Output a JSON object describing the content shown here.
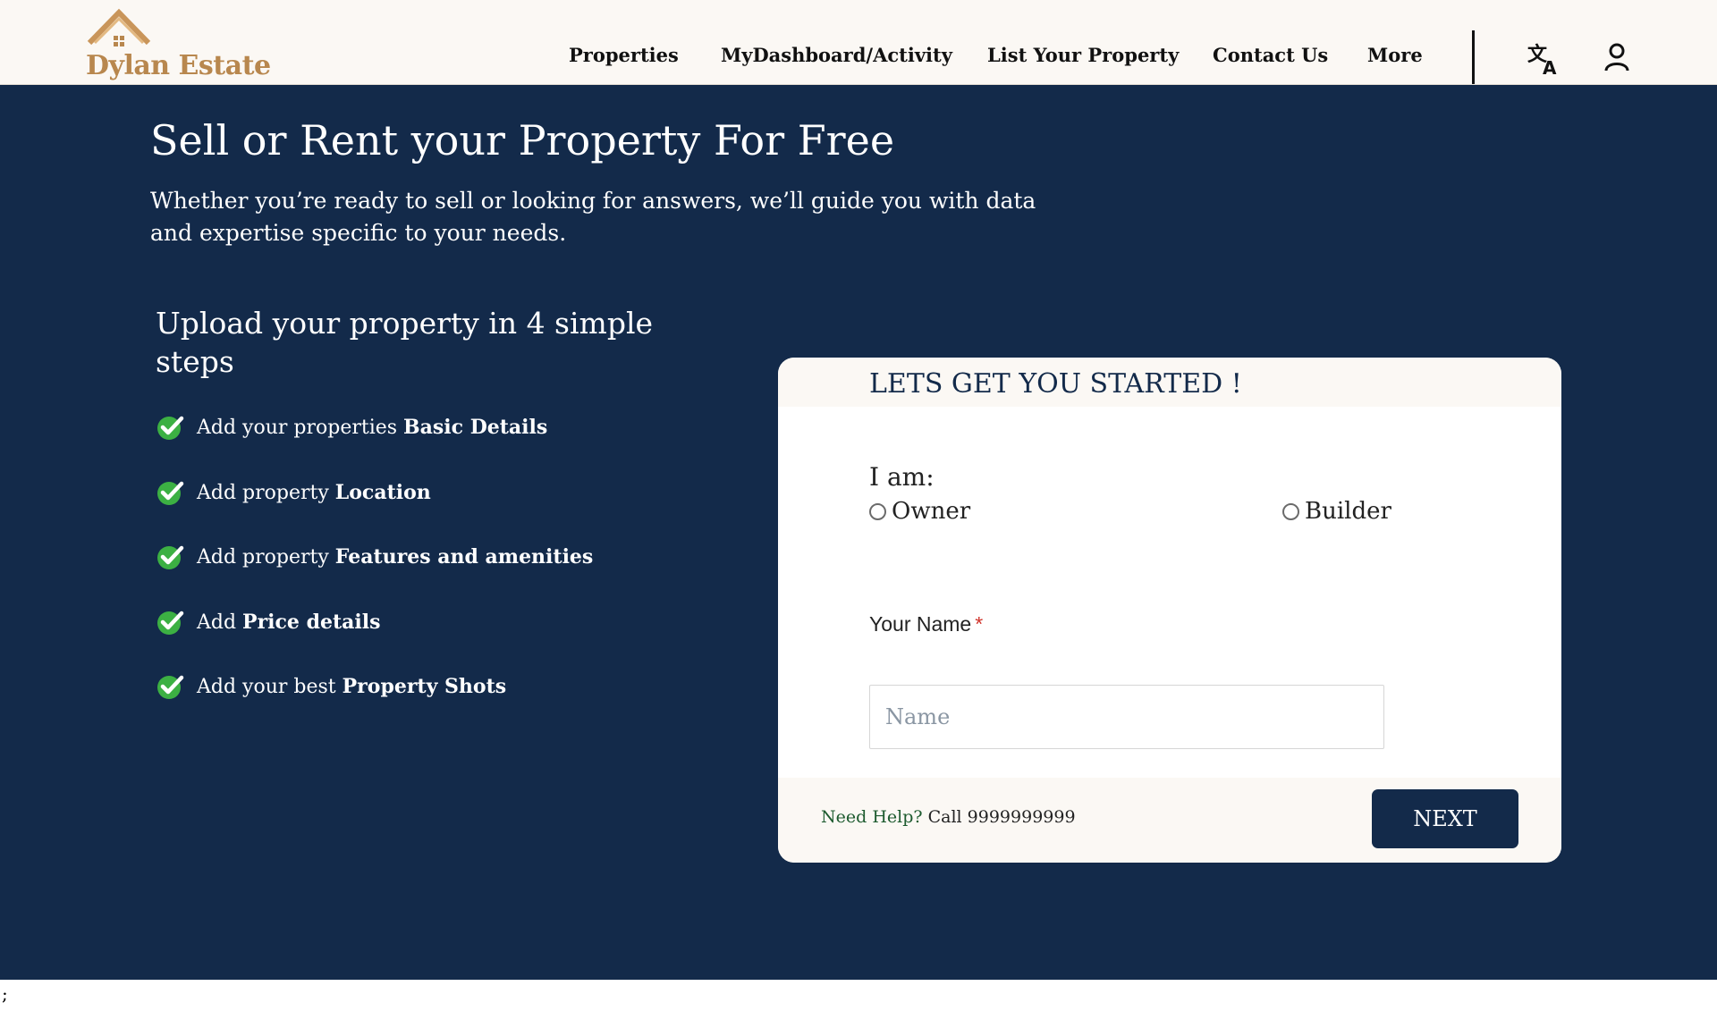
{
  "brand": {
    "name": "Dylan Estate",
    "color": "#b8874e"
  },
  "nav": {
    "items": [
      "Properties",
      "MyDashboard/Activity",
      "List Your Property",
      "Contact Us",
      "More"
    ]
  },
  "icons": {
    "translate": "translate-icon",
    "user": "user-icon",
    "check": "check-circle-icon",
    "roof": "house-roof-icon"
  },
  "hero": {
    "title": "Sell or Rent your Property For Free",
    "subtitle": "Whether you’re ready to sell or looking for answers, we’ll guide you with data and expertise specific to your needs.",
    "background": "#132a4a"
  },
  "steps": {
    "title": "Upload your property in 4 simple steps",
    "items": [
      {
        "prefix": "Add your properties ",
        "bold": "Basic Details"
      },
      {
        "prefix": "Add property ",
        "bold": "Location"
      },
      {
        "prefix": "Add property ",
        "bold": "Features and amenities"
      },
      {
        "prefix": "Add ",
        "bold": "Price details"
      },
      {
        "prefix": "Add your best ",
        "bold": "Property Shots"
      }
    ]
  },
  "form": {
    "title": "LETS GET YOU STARTED !",
    "iam_label": "I am:",
    "roles": [
      "Owner",
      "Builder"
    ],
    "name_label": "Your Name",
    "required_mark": "*",
    "name_placeholder": "Name",
    "name_value": "",
    "help_link": "Need Help?",
    "help_call": " Call 9999999999",
    "next_label": "NEXT"
  },
  "stray_text": ";"
}
